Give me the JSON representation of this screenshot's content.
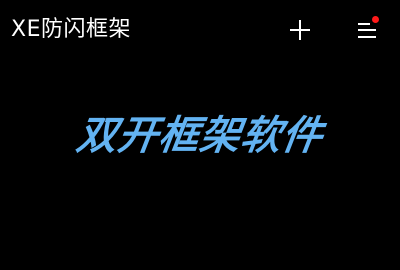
{
  "header": {
    "title": "XE防闪框架",
    "add_icon": "plus-icon",
    "menu_icon": "hamburger-menu-icon",
    "notification_dot_color": "#ff1a1a"
  },
  "main": {
    "headline": "双开框架软件",
    "headline_color": "#63b3f2"
  },
  "theme": {
    "background": "#000000",
    "text": "#ffffff"
  }
}
